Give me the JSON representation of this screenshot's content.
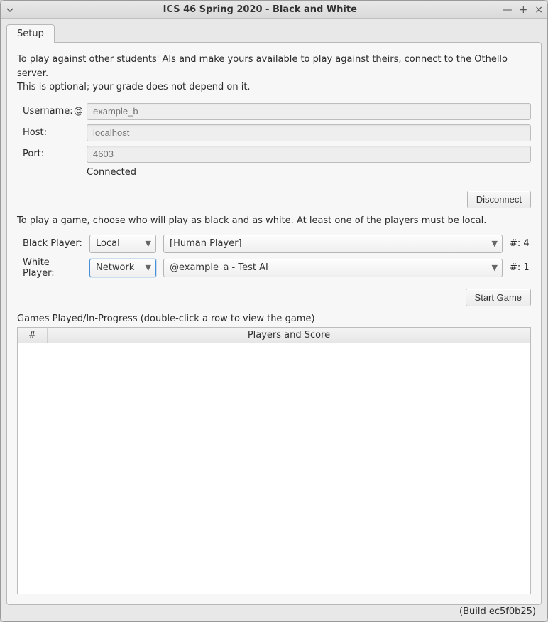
{
  "window": {
    "title": "ICS 46 Spring 2020 - Black and White"
  },
  "tabs": {
    "setup": "Setup"
  },
  "intro": {
    "line1": "To play against other students' AIs and make yours available to play against theirs, connect to the Othello server.",
    "line2": "This is optional; your grade does not depend on it."
  },
  "connection": {
    "username_label": "Username:",
    "username_prefix": "@",
    "username_placeholder": "example_b",
    "host_label": "Host:",
    "host_placeholder": "localhost",
    "port_label": "Port:",
    "port_placeholder": "4603",
    "status": "Connected",
    "disconnect_button": "Disconnect"
  },
  "game_setup": {
    "instructions": "To play a game, choose who will play as black and as white.  At least one of the players must be local.",
    "black_label": "Black Player:",
    "black_source": "Local",
    "black_player": "[Human Player]",
    "black_count_label": "#:",
    "black_count": "4",
    "white_label": "White Player:",
    "white_source": "Network",
    "white_player": "@example_a - Test AI",
    "white_count_label": "#:",
    "white_count": "1",
    "start_button": "Start Game"
  },
  "games_table": {
    "label": "Games Played/In-Progress (double-click a row to view the game)",
    "col_num": "#",
    "col_players": "Players and Score"
  },
  "footer": {
    "build": "(Build ec5f0b25)"
  }
}
